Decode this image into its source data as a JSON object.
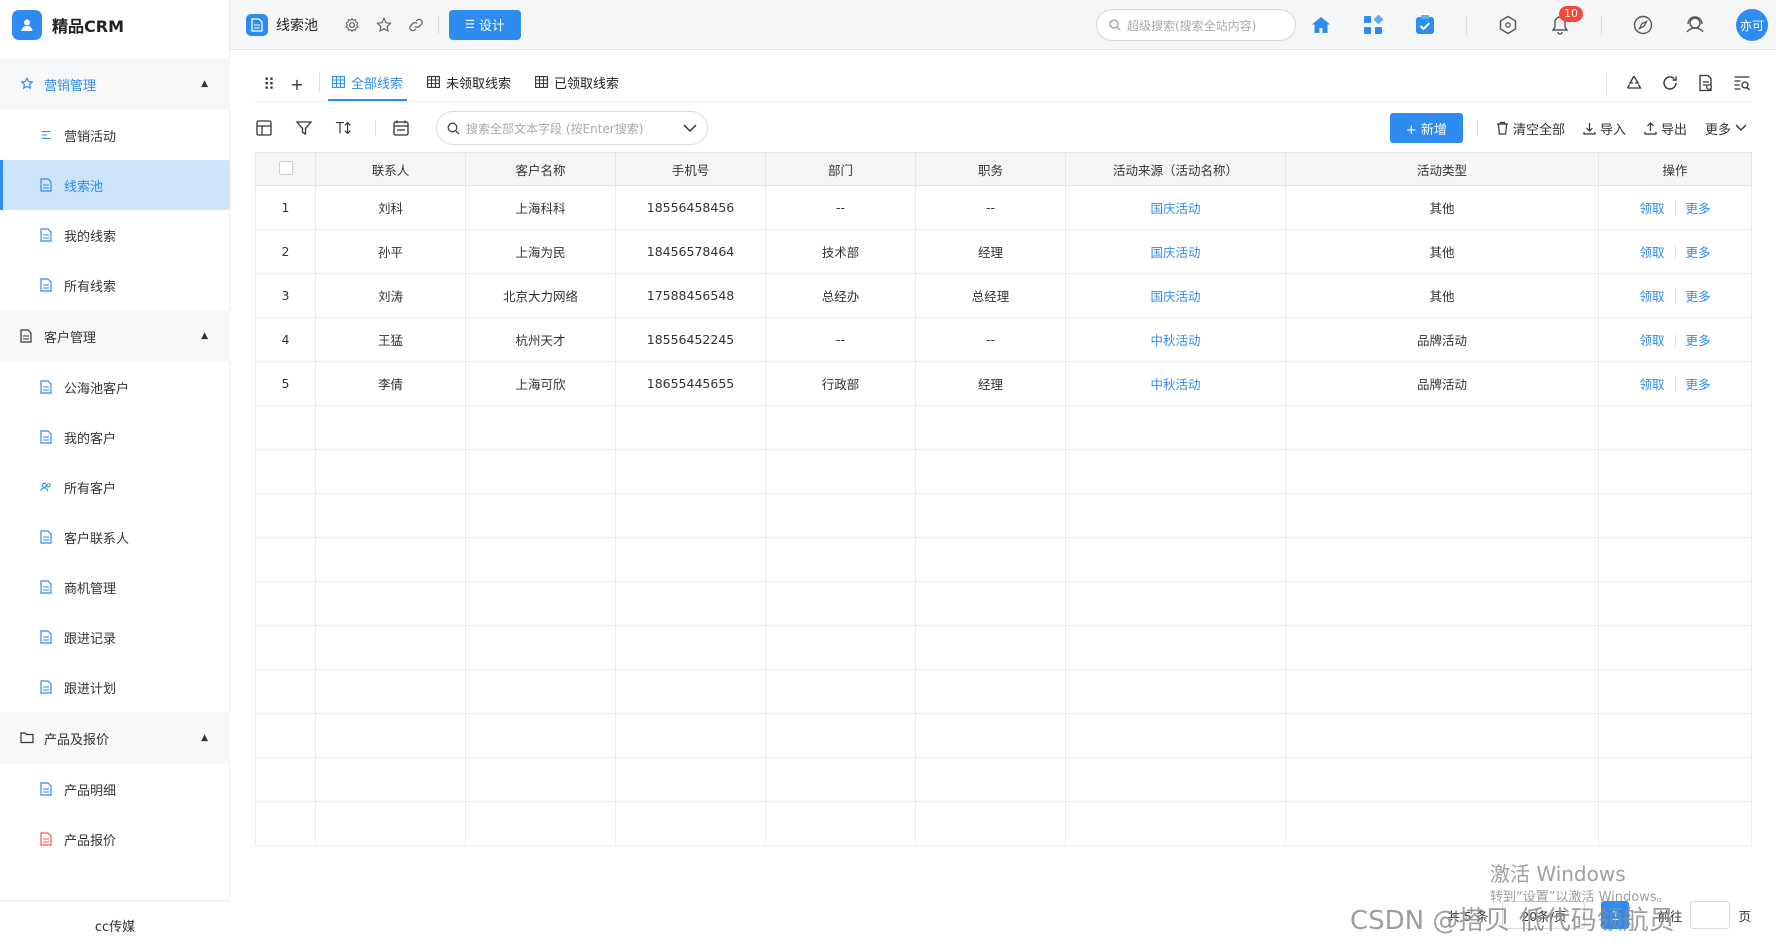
{
  "app": {
    "name": "精品CRM"
  },
  "sidebar": {
    "groups": [
      {
        "label": "营销管理",
        "icon": "marketing-icon",
        "items": [
          {
            "label": "营销活动",
            "icon": "activity-icon"
          },
          {
            "label": "线索池",
            "icon": "document-icon"
          },
          {
            "label": "我的线索",
            "icon": "document-icon"
          },
          {
            "label": "所有线索",
            "icon": "document-icon"
          }
        ]
      },
      {
        "label": "客户管理",
        "icon": "document-icon",
        "items": [
          {
            "label": "公海池客户",
            "icon": "document-icon"
          },
          {
            "label": "我的客户",
            "icon": "document-icon"
          },
          {
            "label": "所有客户",
            "icon": "users-icon"
          },
          {
            "label": "客户联系人",
            "icon": "document-icon"
          },
          {
            "label": "商机管理",
            "icon": "document-icon"
          },
          {
            "label": "跟进记录",
            "icon": "document-icon"
          },
          {
            "label": "跟进计划",
            "icon": "document-icon"
          }
        ]
      },
      {
        "label": "产品及报价",
        "icon": "folder-icon",
        "items": [
          {
            "label": "产品明细",
            "icon": "document-icon"
          },
          {
            "label": "产品报价",
            "icon": "document-red-icon"
          }
        ]
      }
    ],
    "active_item": "线索池",
    "footer": "cc传媒"
  },
  "topbar": {
    "page_title": "线索池",
    "design_label": "设计",
    "search_placeholder": "超级搜索(搜索全站内容)",
    "notification_count": "10",
    "avatar_text": "亦可"
  },
  "tabs": {
    "items": [
      {
        "label": "全部线索",
        "active": true
      },
      {
        "label": "未领取线索",
        "active": false
      },
      {
        "label": "已领取线索",
        "active": false
      }
    ]
  },
  "toolbar": {
    "search_placeholder": "搜索全部文本字段 (按Enter搜索)",
    "add_label": "+ 新增",
    "clear_label": "清空全部",
    "import_label": "导入",
    "export_label": "导出",
    "more_label": "更多"
  },
  "table": {
    "columns": [
      "",
      "联系人",
      "客户名称",
      "手机号",
      "部门",
      "职务",
      "活动来源（活动名称）",
      "活动类型",
      "操作"
    ],
    "rows": [
      {
        "no": "1",
        "contact": "刘科",
        "customer": "上海科科",
        "phone": "18556458456",
        "dept": "--",
        "title": "--",
        "source": "国庆活动",
        "type": "其他"
      },
      {
        "no": "2",
        "contact": "孙平",
        "customer": "上海为民",
        "phone": "18456578464",
        "dept": "技术部",
        "title": "经理",
        "source": "国庆活动",
        "type": "其他"
      },
      {
        "no": "3",
        "contact": "刘涛",
        "customer": "北京大力网络",
        "phone": "17588456548",
        "dept": "总经办",
        "title": "总经理",
        "source": "国庆活动",
        "type": "其他"
      },
      {
        "no": "4",
        "contact": "王猛",
        "customer": "杭州天才",
        "phone": "18556452245",
        "dept": "--",
        "title": "--",
        "source": "中秋活动",
        "type": "品牌活动"
      },
      {
        "no": "5",
        "contact": "李倩",
        "customer": "上海可欣",
        "phone": "18655445655",
        "dept": "行政部",
        "title": "经理",
        "source": "中秋活动",
        "type": "品牌活动"
      }
    ],
    "op_claim": "领取",
    "op_more": "更多"
  },
  "pager": {
    "total": "共 5 条",
    "size": "20条/页",
    "current": "1",
    "goto": "前往",
    "page_suffix": "页"
  },
  "overlays": {
    "activate_title": "激活 Windows",
    "activate_sub": "转到“设置”以激活 Windows。",
    "csdn": "CSDN @搭贝 低代码领航员"
  }
}
